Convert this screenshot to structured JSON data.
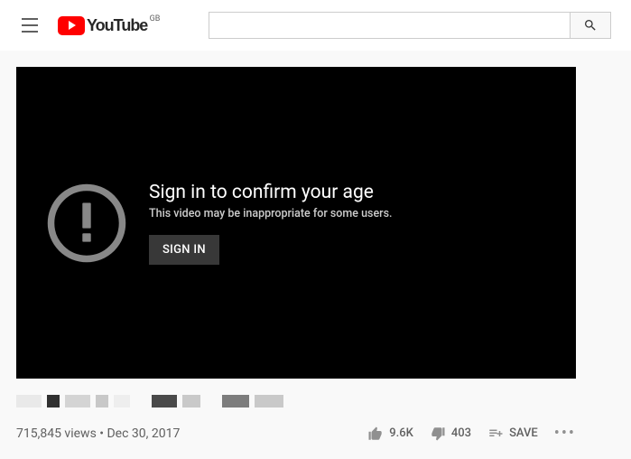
{
  "header": {
    "brand": "YouTube",
    "country_code": "GB",
    "search_placeholder": ""
  },
  "player_gate": {
    "heading": "Sign in to confirm your age",
    "subtext": "This video may be inappropriate for some users.",
    "sign_in_label": "SIGN IN"
  },
  "meta": {
    "views": "715,845 views",
    "separator": " • ",
    "date": "Dec 30, 2017"
  },
  "actions": {
    "like_count": "9.6K",
    "dislike_count": "403",
    "save_label": "SAVE"
  }
}
